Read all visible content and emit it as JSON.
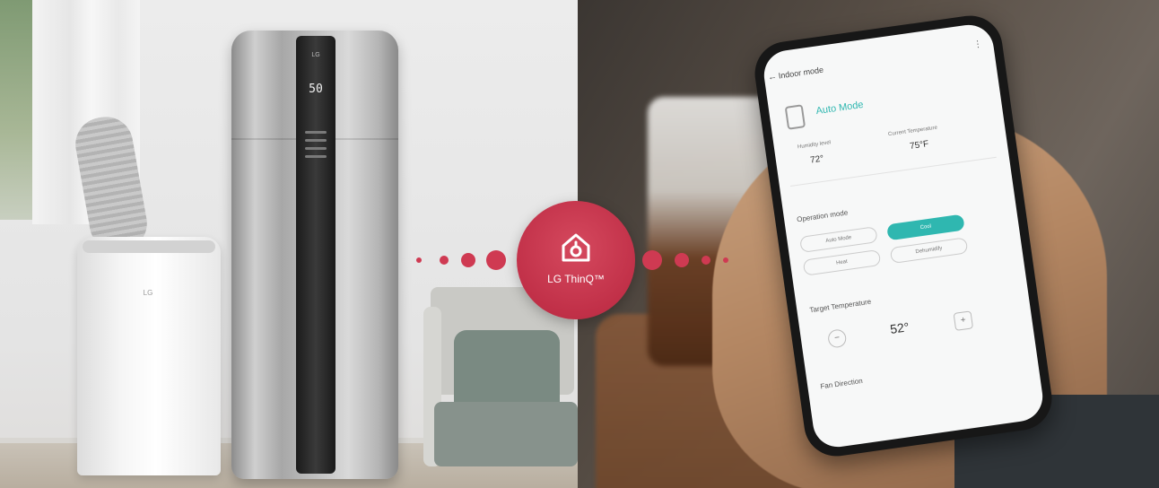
{
  "tower_display": "50",
  "tower_brand": "LG",
  "ac_brand": "LG",
  "badge": {
    "label": "LG ThinQ™",
    "color": "#c8354d"
  },
  "phone": {
    "header": "Indoor mode",
    "mode": "Auto Mode",
    "stat1_label": "Humidity level",
    "stat1_value": "72°",
    "stat2_label": "Current Temperature",
    "stat2_value": "75°F",
    "section1": "Operation mode",
    "chips": [
      "Auto Mode",
      "Cool",
      "Heat",
      "Dehumidify"
    ],
    "section2": "Target Temperature",
    "target_temp": "52°",
    "section3": "Fan Direction",
    "accent_color": "#2fb7b0"
  }
}
